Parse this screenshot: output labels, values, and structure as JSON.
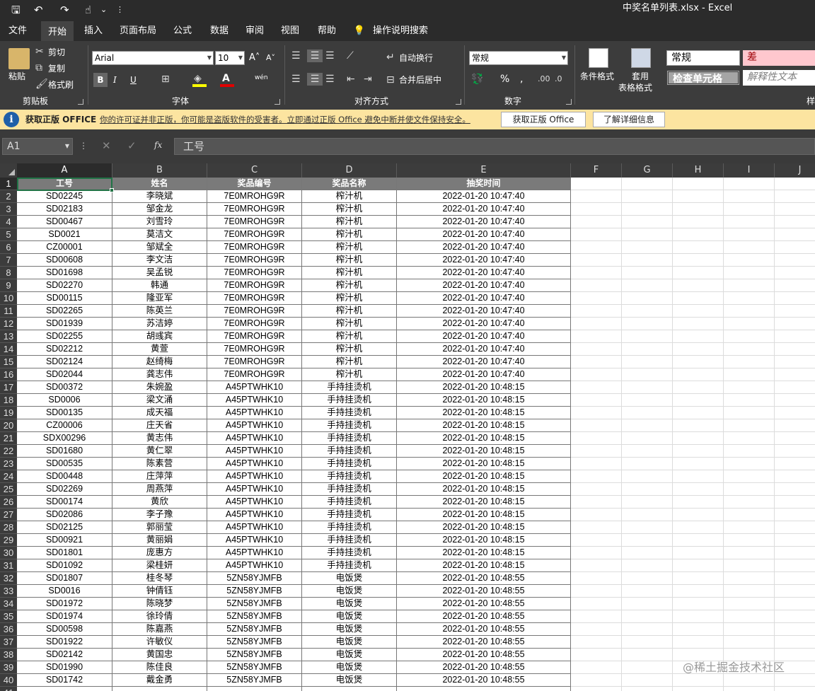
{
  "window": {
    "title": "中奖名单列表.xlsx  -   Excel"
  },
  "quick_access": {
    "save": "🖫",
    "undo": "↶",
    "redo": "↷",
    "touch": "☝",
    "more": "⌄",
    "customize": "⋮"
  },
  "tabs": [
    {
      "label": "文件",
      "active": false
    },
    {
      "label": "开始",
      "active": true
    },
    {
      "label": "插入",
      "active": false
    },
    {
      "label": "页面布局",
      "active": false
    },
    {
      "label": "公式",
      "active": false
    },
    {
      "label": "数据",
      "active": false
    },
    {
      "label": "审阅",
      "active": false
    },
    {
      "label": "视图",
      "active": false
    },
    {
      "label": "帮助",
      "active": false
    },
    {
      "label": "操作说明搜索",
      "active": false
    }
  ],
  "ribbon": {
    "clipboard": {
      "paste": "粘贴",
      "cut": "剪切",
      "copy": "复制",
      "format_painter": "格式刷",
      "group": "剪贴板"
    },
    "font": {
      "name": "Arial",
      "size": "10",
      "group": "字体",
      "bold": "B",
      "italic": "I",
      "underline": "U",
      "grow": "A˄",
      "shrink": "A˅",
      "phonetic": "wén"
    },
    "alignment": {
      "wrap": "自动换行",
      "merge": "合并后居中",
      "group": "对齐方式"
    },
    "number": {
      "format": "常规",
      "group": "数字",
      "percent": "%",
      "comma": ","
    },
    "styles": {
      "conditional": "条件格式",
      "table1": "套用",
      "table2": "表格格式",
      "normal": "常规",
      "bad": "差",
      "check": "检查单元格",
      "explanatory": "解释性文本",
      "group": "样"
    }
  },
  "infobar": {
    "title": "获取正版 OFFICE",
    "message": "你的许可证并非正版，你可能是盗版软件的受害者。立即通过正版 Office 避免中断并使文件保持安全。",
    "button1": "获取正版 Office",
    "button2": "了解详细信息"
  },
  "formula_bar": {
    "name_box": "A1",
    "fx": "fx",
    "cancel": "✕",
    "enter": "✓",
    "content": "工号"
  },
  "columns": [
    "A",
    "B",
    "C",
    "D",
    "E",
    "F",
    "G",
    "H",
    "I",
    "J"
  ],
  "headers": [
    "工号",
    "姓名",
    "奖品编号",
    "奖品名称",
    "抽奖时间"
  ],
  "rows": [
    [
      "SD02245",
      "李晓斌",
      "7E0MROHG9R",
      "榨汁机",
      "2022-01-20 10:47:40"
    ],
    [
      "SD02183",
      "邹金龙",
      "7E0MROHG9R",
      "榨汁机",
      "2022-01-20 10:47:40"
    ],
    [
      "SD00467",
      "刘雪玲",
      "7E0MROHG9R",
      "榨汁机",
      "2022-01-20 10:47:40"
    ],
    [
      "SD0021",
      "莫洁文",
      "7E0MROHG9R",
      "榨汁机",
      "2022-01-20 10:47:40"
    ],
    [
      "CZ00001",
      "邹斌全",
      "7E0MROHG9R",
      "榨汁机",
      "2022-01-20 10:47:40"
    ],
    [
      "SD00608",
      "李文洁",
      "7E0MROHG9R",
      "榨汁机",
      "2022-01-20 10:47:40"
    ],
    [
      "SD01698",
      "吴孟锐",
      "7E0MROHG9R",
      "榨汁机",
      "2022-01-20 10:47:40"
    ],
    [
      "SD02270",
      "韩通",
      "7E0MROHG9R",
      "榨汁机",
      "2022-01-20 10:47:40"
    ],
    [
      "SD00115",
      "隆亚军",
      "7E0MROHG9R",
      "榨汁机",
      "2022-01-20 10:47:40"
    ],
    [
      "SD02265",
      "陈英兰",
      "7E0MROHG9R",
      "榨汁机",
      "2022-01-20 10:47:40"
    ],
    [
      "SD01939",
      "苏洁婷",
      "7E0MROHG9R",
      "榨汁机",
      "2022-01-20 10:47:40"
    ],
    [
      "SD02255",
      "胡彧宾",
      "7E0MROHG9R",
      "榨汁机",
      "2022-01-20 10:47:40"
    ],
    [
      "SD02212",
      "黄萱",
      "7E0MROHG9R",
      "榨汁机",
      "2022-01-20 10:47:40"
    ],
    [
      "SD02124",
      "赵绮梅",
      "7E0MROHG9R",
      "榨汁机",
      "2022-01-20 10:47:40"
    ],
    [
      "SD02044",
      "龚志伟",
      "7E0MROHG9R",
      "榨汁机",
      "2022-01-20 10:47:40"
    ],
    [
      "SD00372",
      "朱婉盈",
      "A45PTWHK10",
      "手持挂烫机",
      "2022-01-20 10:48:15"
    ],
    [
      "SD0006",
      "梁文涌",
      "A45PTWHK10",
      "手持挂烫机",
      "2022-01-20 10:48:15"
    ],
    [
      "SD00135",
      "成天福",
      "A45PTWHK10",
      "手持挂烫机",
      "2022-01-20 10:48:15"
    ],
    [
      "CZ00006",
      "庄天省",
      "A45PTWHK10",
      "手持挂烫机",
      "2022-01-20 10:48:15"
    ],
    [
      "SDX00296",
      "黄志伟",
      "A45PTWHK10",
      "手持挂烫机",
      "2022-01-20 10:48:15"
    ],
    [
      "SD01680",
      "黄仁翠",
      "A45PTWHK10",
      "手持挂烫机",
      "2022-01-20 10:48:15"
    ],
    [
      "SD00535",
      "陈素营",
      "A45PTWHK10",
      "手持挂烫机",
      "2022-01-20 10:48:15"
    ],
    [
      "SD00448",
      "庄萍萍",
      "A45PTWHK10",
      "手持挂烫机",
      "2022-01-20 10:48:15"
    ],
    [
      "SD02269",
      "周燕萍",
      "A45PTWHK10",
      "手持挂烫机",
      "2022-01-20 10:48:15"
    ],
    [
      "SD00174",
      "黄欣",
      "A45PTWHK10",
      "手持挂烫机",
      "2022-01-20 10:48:15"
    ],
    [
      "SD02086",
      "李子豫",
      "A45PTWHK10",
      "手持挂烫机",
      "2022-01-20 10:48:15"
    ],
    [
      "SD02125",
      "郭丽莹",
      "A45PTWHK10",
      "手持挂烫机",
      "2022-01-20 10:48:15"
    ],
    [
      "SD00921",
      "黄丽娟",
      "A45PTWHK10",
      "手持挂烫机",
      "2022-01-20 10:48:15"
    ],
    [
      "SD01801",
      "庞惠方",
      "A45PTWHK10",
      "手持挂烫机",
      "2022-01-20 10:48:15"
    ],
    [
      "SD01092",
      "梁桂妍",
      "A45PTWHK10",
      "手持挂烫机",
      "2022-01-20 10:48:15"
    ],
    [
      "SD01807",
      "桂冬琴",
      "5ZN58YJMFB",
      "电饭煲",
      "2022-01-20 10:48:55"
    ],
    [
      "SD0016",
      "钟倩钰",
      "5ZN58YJMFB",
      "电饭煲",
      "2022-01-20 10:48:55"
    ],
    [
      "SD01972",
      "陈晓梦",
      "5ZN58YJMFB",
      "电饭煲",
      "2022-01-20 10:48:55"
    ],
    [
      "SD01974",
      "徐玲倩",
      "5ZN58YJMFB",
      "电饭煲",
      "2022-01-20 10:48:55"
    ],
    [
      "SD00598",
      "陈嘉燕",
      "5ZN58YJMFB",
      "电饭煲",
      "2022-01-20 10:48:55"
    ],
    [
      "SD01922",
      "许敏仪",
      "5ZN58YJMFB",
      "电饭煲",
      "2022-01-20 10:48:55"
    ],
    [
      "SD02142",
      "黄国忠",
      "5ZN58YJMFB",
      "电饭煲",
      "2022-01-20 10:48:55"
    ],
    [
      "SD01990",
      "陈佳良",
      "5ZN58YJMFB",
      "电饭煲",
      "2022-01-20 10:48:55"
    ],
    [
      "SD01742",
      "戴金勇",
      "5ZN58YJMFB",
      "电饭煲",
      "2022-01-20 10:48:55"
    ]
  ],
  "watermark": "@稀土掘金技术社区",
  "colors": {
    "selected": "#217346",
    "header_fill": "#7a7a7a",
    "dark": "#2b2b2b",
    "infobar": "#fce4a0"
  }
}
